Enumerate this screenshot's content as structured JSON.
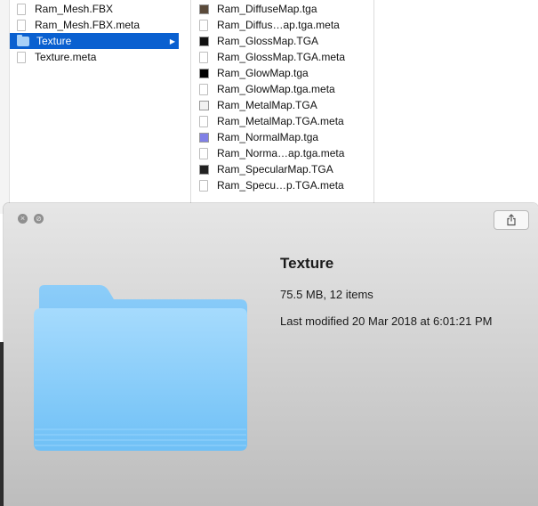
{
  "finder": {
    "column1": [
      {
        "name": "Ram_Mesh.FBX",
        "kind": "doc",
        "selected": false
      },
      {
        "name": "Ram_Mesh.FBX.meta",
        "kind": "doc",
        "selected": false
      },
      {
        "name": "Texture",
        "kind": "folder",
        "selected": true
      },
      {
        "name": "Texture.meta",
        "kind": "doc",
        "selected": false
      }
    ],
    "column2": [
      {
        "name": "Ram_DiffuseMap.tga",
        "thumb": "#5a4a3a"
      },
      {
        "name": "Ram_Diffus…ap.tga.meta",
        "thumb": ""
      },
      {
        "name": "Ram_GlossMap.TGA",
        "thumb": "#111111"
      },
      {
        "name": "Ram_GlossMap.TGA.meta",
        "thumb": ""
      },
      {
        "name": "Ram_GlowMap.tga",
        "thumb": "#000000"
      },
      {
        "name": "Ram_GlowMap.tga.meta",
        "thumb": ""
      },
      {
        "name": "Ram_MetalMap.TGA",
        "thumb": "#f2f2f2"
      },
      {
        "name": "Ram_MetalMap.TGA.meta",
        "thumb": ""
      },
      {
        "name": "Ram_NormalMap.tga",
        "thumb": "#8080e6"
      },
      {
        "name": "Ram_Norma…ap.tga.meta",
        "thumb": ""
      },
      {
        "name": "Ram_SpecularMap.TGA",
        "thumb": "#222222"
      },
      {
        "name": "Ram_Specu…p.TGA.meta",
        "thumb": ""
      }
    ]
  },
  "quicklook": {
    "title": "Texture",
    "size_items": "75.5 MB, 12 items",
    "modified": "Last modified 20 Mar 2018 at 6:01:21 PM",
    "close_glyph": "×",
    "fullscreen_glyph": "⊘"
  },
  "colors": {
    "selection": "#0a60d0",
    "folder_light": "#9dd4fb",
    "folder_dark": "#6cb9f2"
  }
}
